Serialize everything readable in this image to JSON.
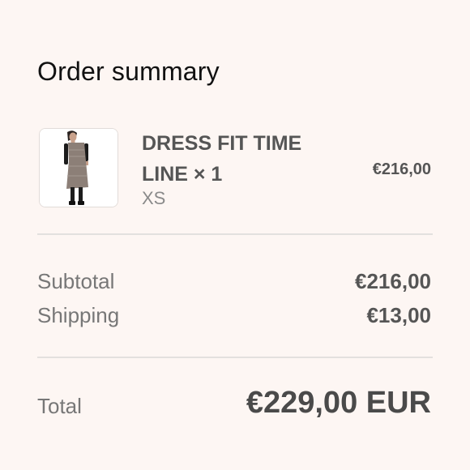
{
  "summary": {
    "title": "Order summary"
  },
  "item": {
    "image_alt": "product-photo",
    "name": "DRESS FIT TIME LINE × 1",
    "variant": "XS",
    "price": "€216,00"
  },
  "totals": {
    "subtotal_label": "Subtotal",
    "subtotal_value": "€216,00",
    "shipping_label": "Shipping",
    "shipping_value": "€13,00",
    "total_label": "Total",
    "total_value": "€229,00 EUR"
  },
  "colors": {
    "background": "#fdf6f3",
    "text_strong": "#111111",
    "text_muted": "#777777",
    "divider": "#e3e0de"
  }
}
